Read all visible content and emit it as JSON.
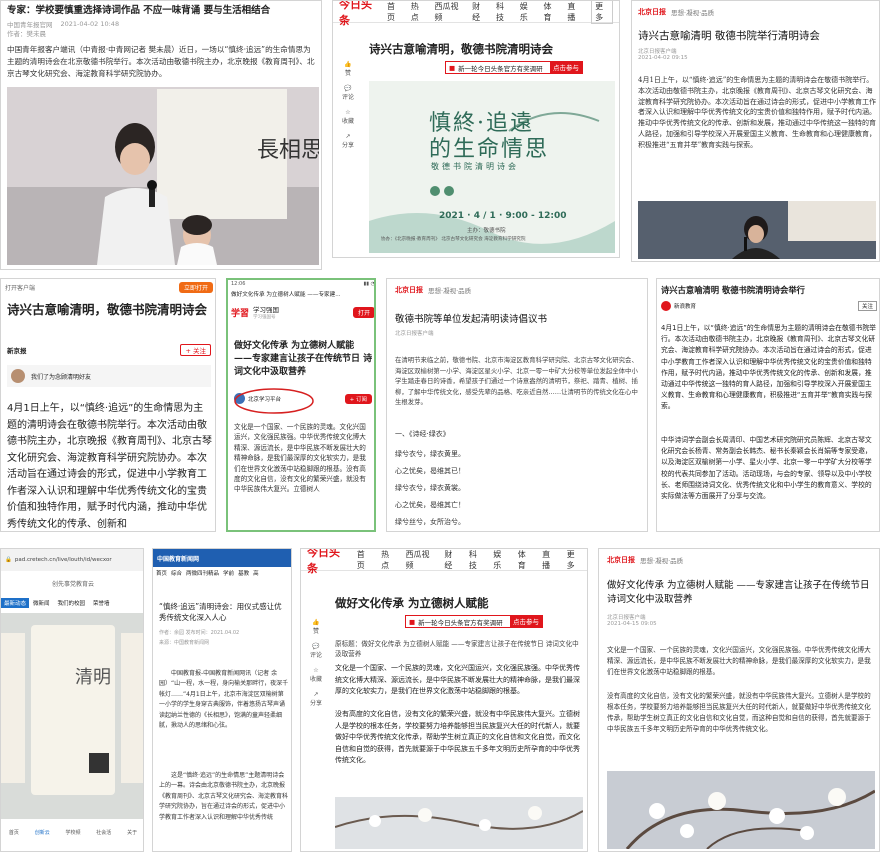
{
  "p1": {
    "title": "专家：学校要慎重选择诗词作品 不应一味背诵 要与生活相结合",
    "source": "中国青年报官网",
    "date": "2021-04-02 10:48",
    "author": "作者：樊未晨",
    "body": "中国青年报客户端讯（中青报·中青网记者 樊未晨）近日，一场以“慎终·追远”的生命情思为主题的清明诗会在北京敬德书院举行。本次活动由敬德书院主办，北京晚报《教育周刊》、北京古琴文化研究会、海淀教育科学研究院协办。"
  },
  "p2": {
    "logo": "今日头条",
    "nav": [
      "首页",
      "热点",
      "西瓜视频",
      "财经",
      "科技",
      "娱乐",
      "体育",
      "直播",
      "更多"
    ],
    "title": "诗兴古意喻清明，敬德书院清明诗会",
    "banner": "新一轮今日头条官方有奖调研",
    "banner_btn": "点击参与",
    "rail": [
      "赞",
      "评论",
      "收藏",
      "分享"
    ],
    "poster_title1": "慎終·追遠",
    "poster_title2": "的生命情思",
    "poster_sub": "敬德书院清明诗会",
    "poster_date": "2021 · 4 / 1 · 9:00 - 12:00",
    "poster_org": "主办：敬德书院",
    "poster_co": "协办：《北京晚报·教育周刊》  北京古琴文化研究会  海淀教育科学研究院"
  },
  "p3": {
    "brand": "思想·凝视·品质",
    "title": "诗兴古意喻清明 敬德书院举行清明诗会",
    "meta": "北京日报客户端",
    "date": "2021-04-02 09:15",
    "body": "4月1日上午，以“慎终·追远”的生命情思为主题的清明诗会在敬德书院举行。本次活动由敬德书院主办，北京晚报《教育周刊》、北京古琴文化研究会、海淀教育科学研究院协办。本次活动旨在通过诗会的形式，促进中小学教育工作者深入认识和理解中华优秀传统文化的宝贵价值和独特作用，赋予时代内涵。推动中华优秀传统文化的传承、创新和发展，推动通过中华传统这一独特的育人路径，加强和引导学校深入开展爱国主义教育、生命教育和心理健康教育，积极推进“五育并举”教育实践与探索。"
  },
  "p4": {
    "status": "打开客户端",
    "badge": "立即打开",
    "title": "诗兴古意喻清明，敬德书院清明诗会",
    "author": "新京报",
    "follow": "+ 关注",
    "comment": "我们了为念顾清明好友",
    "body": "4月1日上午，以“慎终·追远”的生命情思为主题的清明诗会在敬德书院举行。本次活动由敬德书院主办，北京晚报《教育周刊》、北京古琴文化研究会、海淀教育科学研究院协办。本次活动旨在通过诗会的形式，促进中小学教育工作者深入认识和理解中华优秀传统文化的宝贵价值和独特作用，赋予时代内涵，推动中华优秀传统文化的传承、创新和"
  },
  "p5": {
    "time": "12:06",
    "bar_title": "做好文化传承 为立德树人赋能 ——专家建...",
    "app": "学习强国",
    "app_sub": "学习强国号",
    "open": "打开",
    "title": "做好文化传承 为立德树人赋能 ——专家建言让孩子在传统节日 诗词文化中汲取营养",
    "account": "北京学习平台",
    "sub_btn": "+ 订阅",
    "body": "文化是一个国家、一个民族的灵魂。文化兴国运兴，文化强民族强。中华优秀传统文化博大精深、源远流长，是中华民族不断发展壮大的精神命脉，是我们最深厚的文化软实力，是我们在世界文化激荡中站稳脚跟的根基。没有高度的文化自信，没有文化的繁荣兴盛，就没有中华民族伟大复兴。立德树人"
  },
  "p6": {
    "brand": "思想·凝视·品质",
    "title": "敬德书院等单位发起清明读诗倡议书",
    "meta": "北京日报客户端",
    "body": "在清明节来临之前，敬德书院、北京市海淀区教育科学研究院、北京古琴文化研究会、海淀区双榆树第一小学、海淀区星火小学、北京一零一中矿大分校等单位发起全体中小学生踏走春日的诗香，希望孩子们通过一个诗意盎然的清明节，祭祀、踏青、植树、插柳，了解中华传统文化，感受先辈的品格、吃亲近自然……让清明节的传统文化在心中生根发芽。",
    "s1": "一、《诗经·绿衣》",
    "l1": "绿兮衣兮，绿衣黄里。",
    "l2": "心之忧矣，曷维其已！",
    "l3": "绿兮衣兮，绿衣黄裳。",
    "l4": "心之忧矣，曷维其亡！",
    "l5": "绿兮丝兮，女所治兮。"
  },
  "p7": {
    "title": "诗兴古意喻清明 敬德书院清明诗会举行",
    "author": "新浪教育",
    "follow": "关注",
    "body": "4月1日上午，以“慎终·追远”的生命情思为主题的清明诗会在敬德书院举行。本次活动由敬德书院主办，北京晚报《教育周刊》、北京古琴文化研究会、海淀教育科学研究院协办。本次活动旨在通过诗会的形式，促进中小学教育工作者深入认识和理解中华优秀传统文化的宝贵价值和独特作用，赋予时代内涵，推动中华优秀传统文化的传承、创新和发展，推动通过中华传统这一独特的育人路径，加强和引导学校深入开展爱国主义教育、生命教育和心理健康教育，积极推进“五育并举”教育实践与探索。",
    "body2": "中华诗词学会副会长周清印、中国艺术研究院研究员陈辉、北京古琴文化研究会长杨青、常务副会长韩杰、秘书长秦颖会长肖娟等专家受邀，以及海淀区双榆树第一小学、星火小学、北京一零一中学矿大分校等学校的代表共同参加了活动。活动现场，与会的专家、领导以及中小学校长、老师围绕诗词文化、优秀传统文化和中小学生的教育意义、学校的实际做法等方面展开了分享与交流。"
  },
  "p8": {
    "url": "pad.cretech.cn/live/louth/id/wecxor",
    "site": "创先事党教育云",
    "tabs": [
      "最新动态",
      "微新闻",
      "我们的校园",
      "荣誉墙"
    ],
    "nav": [
      "首页",
      "创新云",
      "学校频",
      "社会活",
      "关于"
    ]
  },
  "p9": {
    "logo": "中国教育新闻网",
    "nav": [
      "首页",
      "综合",
      "两微四刊精品",
      "学前",
      "基教",
      "高"
    ],
    "title": "“慎终·追远”清明诗会：用仪式感让优秀传统文化深入人心",
    "meta": "作者：余园  发布时间：2021.04.02",
    "src": "来源：中国教育新闻网",
    "body": "中国教育报-中国教育新闻网讯（记者 余园）“山一程，水一程，身向榆关那畔行，夜深千帐灯……”4月1日上午，北京市海淀区双榆树第一小学的学生身穿古典服饰，伴着悠扬古琴声诵读起纳兰性德的《长相思》，饱满的童声轻柔细腻，揪动人的思绪和心弦。",
    "body2": "这是“慎终·追远”的生命情思”主题清明诗会上的一幕。诗会由北京敬德书院主办，北京晚报《教育周刊》、北京古琴文化研究会、海淀教育科学研究院协办，旨在通过诗会的形式，促进中小学教育工作者深入认识和理解中华优秀传统"
  },
  "p10": {
    "logo": "今日头条",
    "nav": [
      "首页",
      "热点",
      "西瓜视频",
      "财经",
      "科技",
      "娱乐",
      "体育",
      "直播",
      "更多"
    ],
    "title": "做好文化传承 为立德树人赋能",
    "meta": "原标题：做好文化传承 为立德树人赋能 ——专家建言让孩子在传统节日 诗词文化中汲取营养",
    "banner": "新一轮今日头条官方有奖调研",
    "banner_btn": "点击参与",
    "rail": [
      "赞",
      "评论",
      "收藏",
      "分享"
    ],
    "body": "文化是一个国家、一个民族的灵魂，文化兴国运兴，文化强民族强。中华优秀传统文化博大精深、源远流长，是中华民族不断发展壮大的精神命脉，是我们最深厚的文化软实力，是我们在世界文化激荡中站稳脚跟的根基。",
    "body2": "没有高度的文化自信，没有文化的繁荣兴盛，就没有中华民族伟大复兴。立德树人是学校的根本任务，学校要努力培养能够担当民族复兴大任的时代新人，就要做好中华优秀传统文化传承，帮助学生树立真正的文化自信和文化自觉，而文化自信和自觉的获得，首先就要源于中华民族五千多年文明历史所孕育的中华优秀传统文化。"
  },
  "p11": {
    "brand": "思想·凝视·品质",
    "title": "做好文化传承 为立德树人赋能 ——专家建言让孩子在传统节日 诗词文化中汲取营养",
    "meta": "北京日报客户端",
    "date": "2021-04-15 09:05",
    "body": "文化是一个国家、一个民族的灵魂，文化兴国运兴，文化强民族强。中华优秀传统文化博大精深、源远流长，是中华民族不断发展壮大的精神命脉，是我们最深厚的文化软实力，是我们在世界文化激荡中站稳脚跟的根基。",
    "body2": "没有高度的文化自信，没有文化的繁荣兴盛，就没有中华民族伟大复兴。立德树人是学校的根本任务，学校要努力培养能够担当民族复兴大任的时代新人，就要做好中华优秀传统文化传承，帮助学生树立真正的文化自信和文化自觉，而这种自觉和自信的获得，首先就要源于中华民族五千多年文明历史所孕育的中华优秀传统文化。"
  }
}
